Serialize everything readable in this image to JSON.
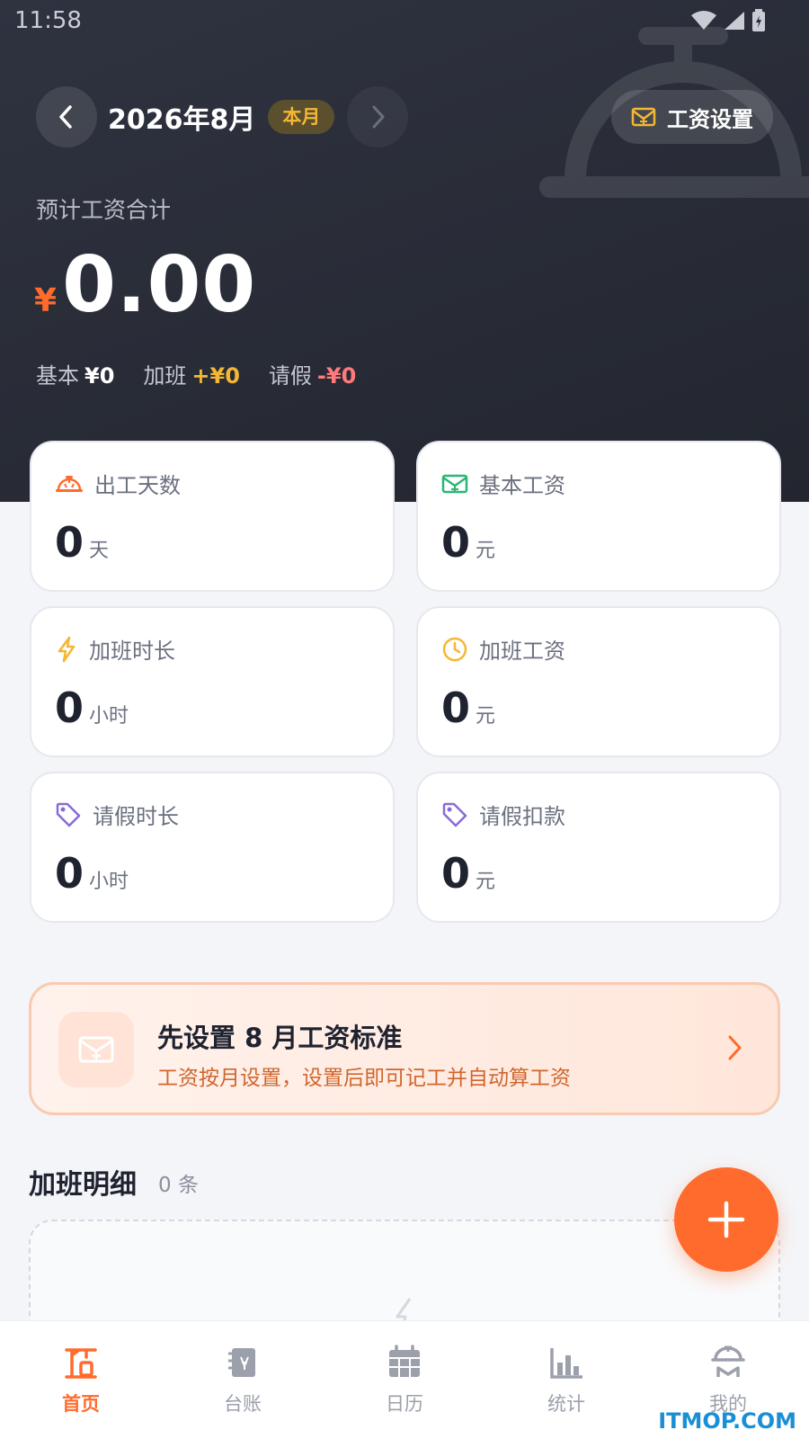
{
  "status": {
    "time": "11:58"
  },
  "header": {
    "month_title": "2026年8月",
    "month_badge": "本月",
    "settings_label": "工资设置",
    "total_label": "预计工资合计",
    "currency": "¥",
    "total_value": "0.00",
    "breakdown": {
      "base_label": "基本",
      "base_value": "¥0",
      "overtime_label": "加班",
      "overtime_value": "+¥0",
      "leave_label": "请假",
      "leave_value": "-¥0"
    }
  },
  "stats": [
    {
      "label": "出工天数",
      "value": "0",
      "unit": "天"
    },
    {
      "label": "基本工资",
      "value": "0",
      "unit": "元"
    },
    {
      "label": "加班时长",
      "value": "0",
      "unit": "小时"
    },
    {
      "label": "加班工资",
      "value": "0",
      "unit": "元"
    },
    {
      "label": "请假时长",
      "value": "0",
      "unit": "小时"
    },
    {
      "label": "请假扣款",
      "value": "0",
      "unit": "元"
    }
  ],
  "banner": {
    "title": "先设置 8 月工资标准",
    "subtitle": "工资按月设置，设置后即可记工并自动算工资"
  },
  "overtime_section": {
    "title": "加班明细",
    "count": "0 条"
  },
  "tabs": [
    {
      "label": "首页"
    },
    {
      "label": "台账"
    },
    {
      "label": "日历"
    },
    {
      "label": "统计"
    },
    {
      "label": "我的"
    }
  ],
  "watermark": "ITMOP.COM",
  "colors": {
    "accent": "#ff6b2c",
    "gold": "#f4b733",
    "green": "#2bb673",
    "purple": "#8a6ad6",
    "dark": "#2a2d38"
  }
}
